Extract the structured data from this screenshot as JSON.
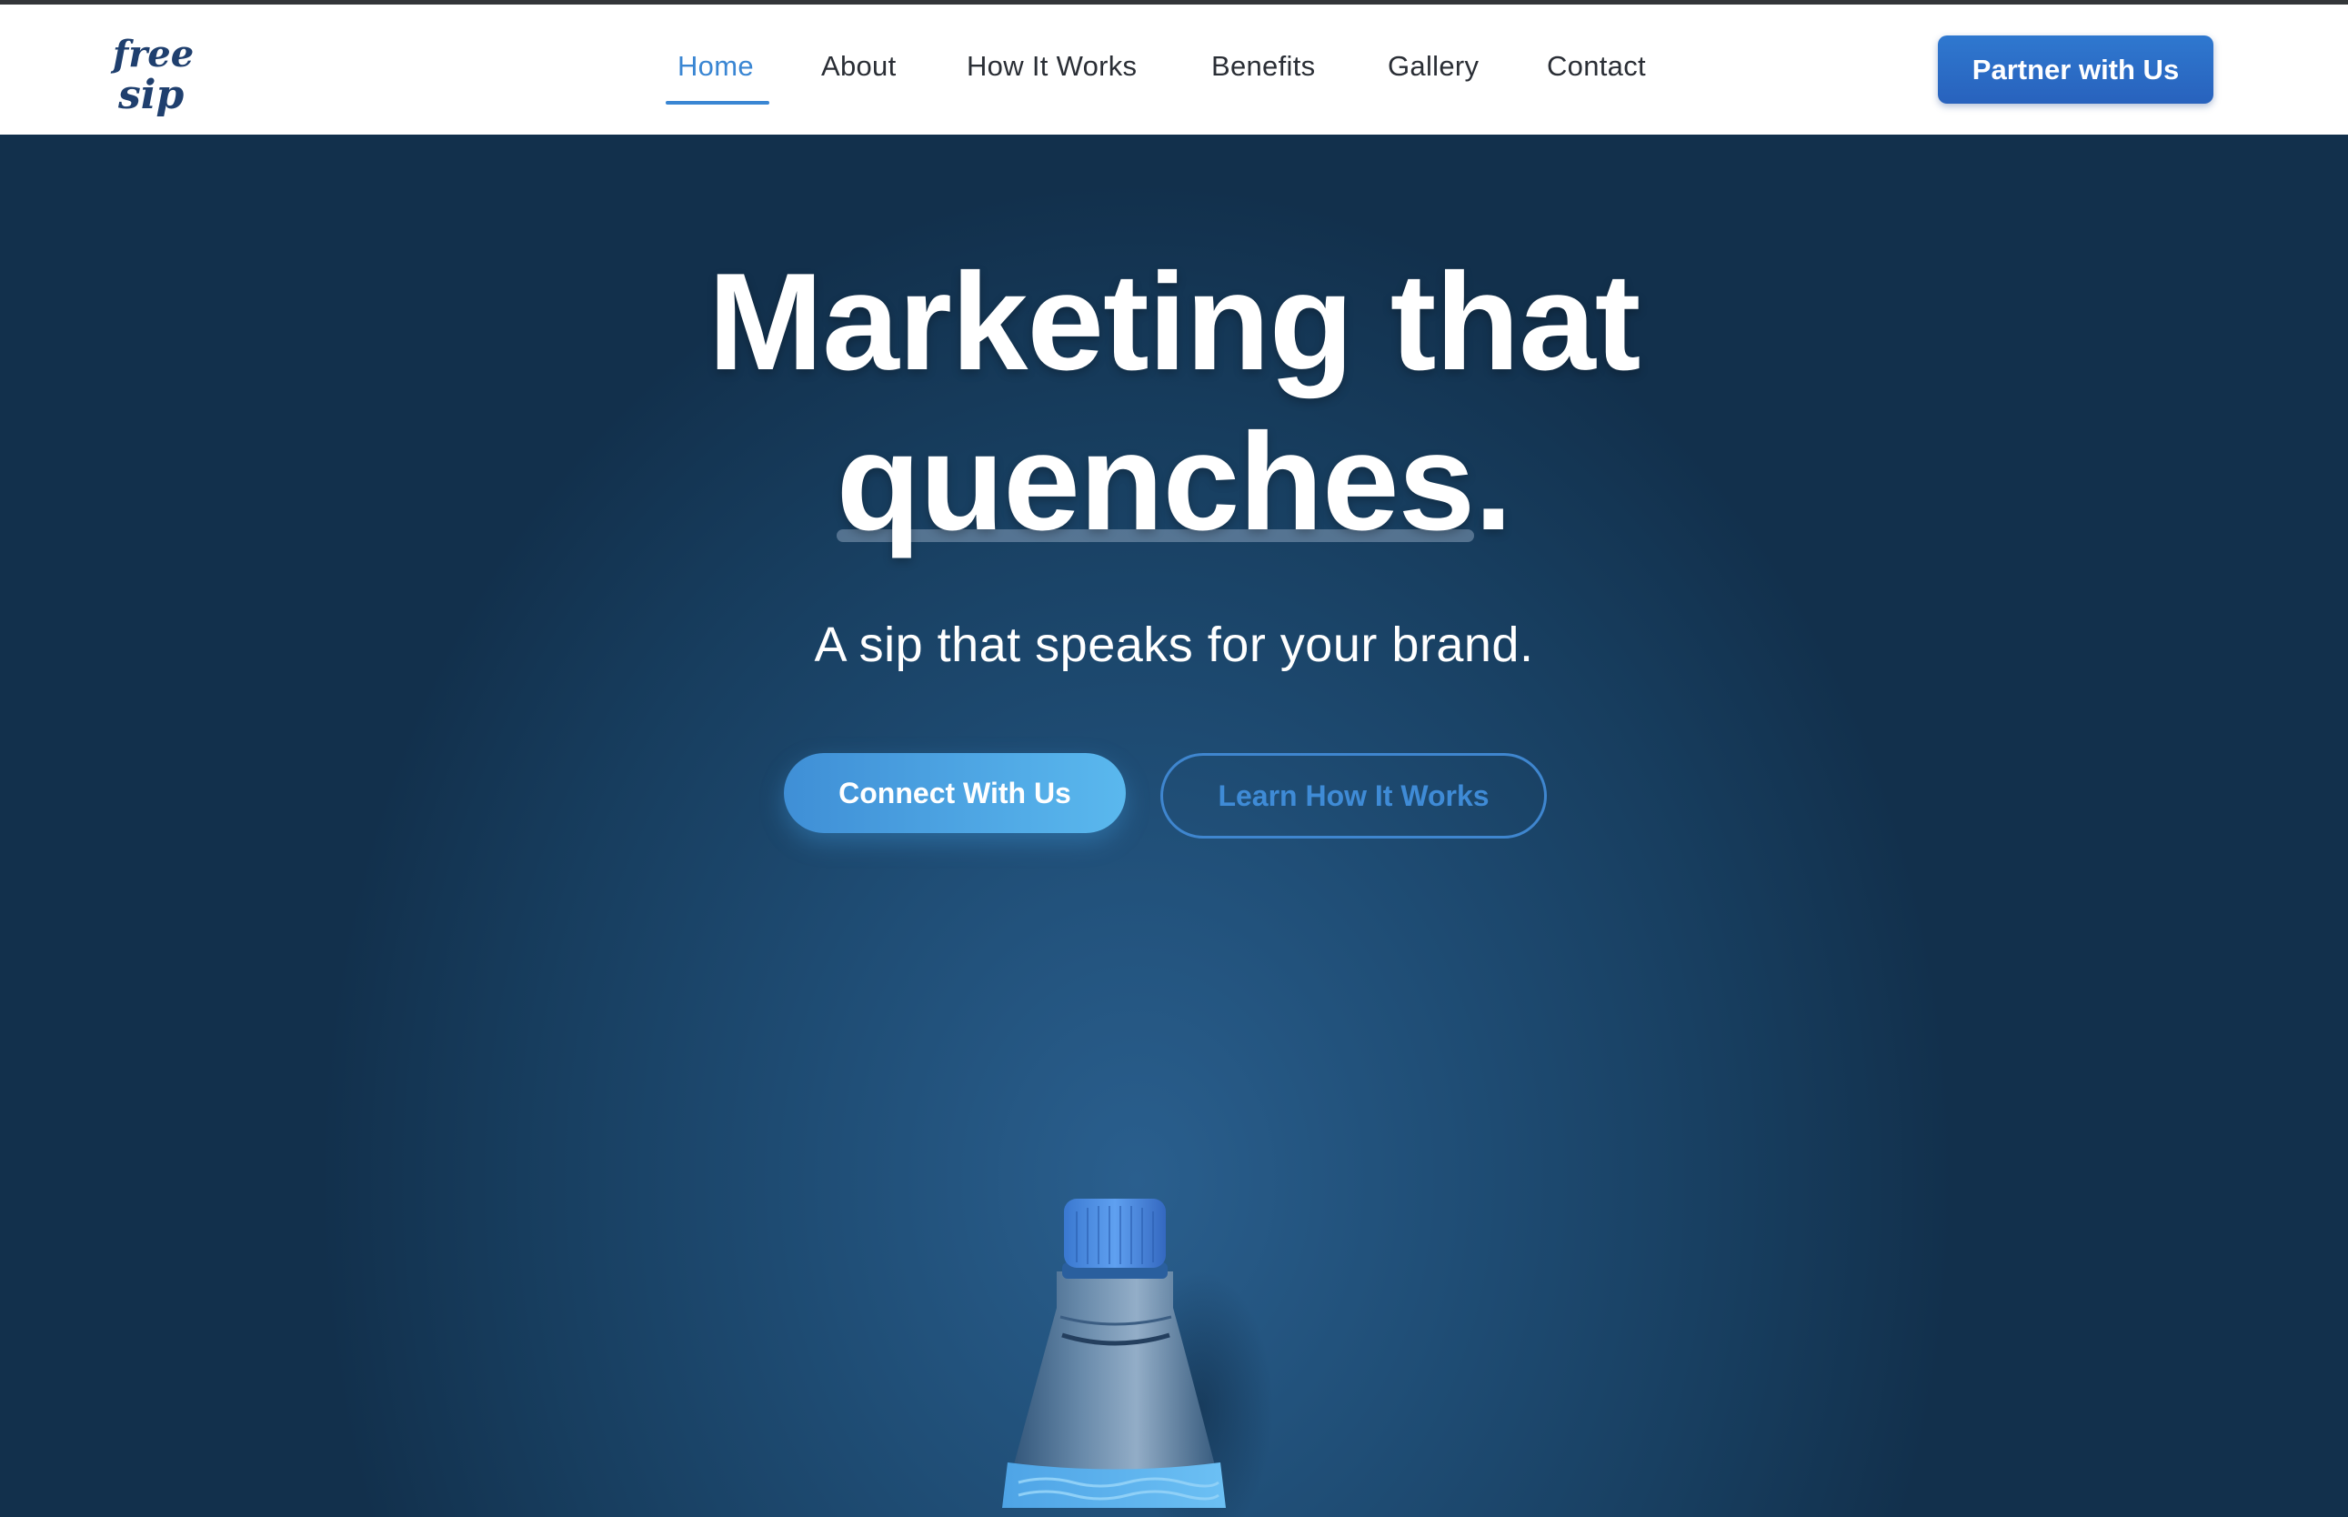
{
  "brand": {
    "logo_text": "free sip",
    "logo_icon": "freesip-logo-icon"
  },
  "nav": {
    "items": [
      {
        "label": "Home",
        "active": true
      },
      {
        "label": "About",
        "active": false
      },
      {
        "label": "How It Works",
        "active": false
      },
      {
        "label": "Benefits",
        "active": false
      },
      {
        "label": "Gallery",
        "active": false
      },
      {
        "label": "Contact",
        "active": false
      }
    ],
    "cta_label": "Partner with Us"
  },
  "hero": {
    "title_line1": "Marketing that",
    "title_highlight": "quenches",
    "title_punct": ".",
    "subtitle": "A sip that speaks for your brand.",
    "primary_button": "Connect With Us",
    "secondary_button": "Learn How It Works",
    "image": "water-bottle-image"
  },
  "colors": {
    "accent": "#3a86d3",
    "cta": "#2b6cc4",
    "hero_bg": "#173d5e",
    "text_dark": "#2a2e35"
  }
}
